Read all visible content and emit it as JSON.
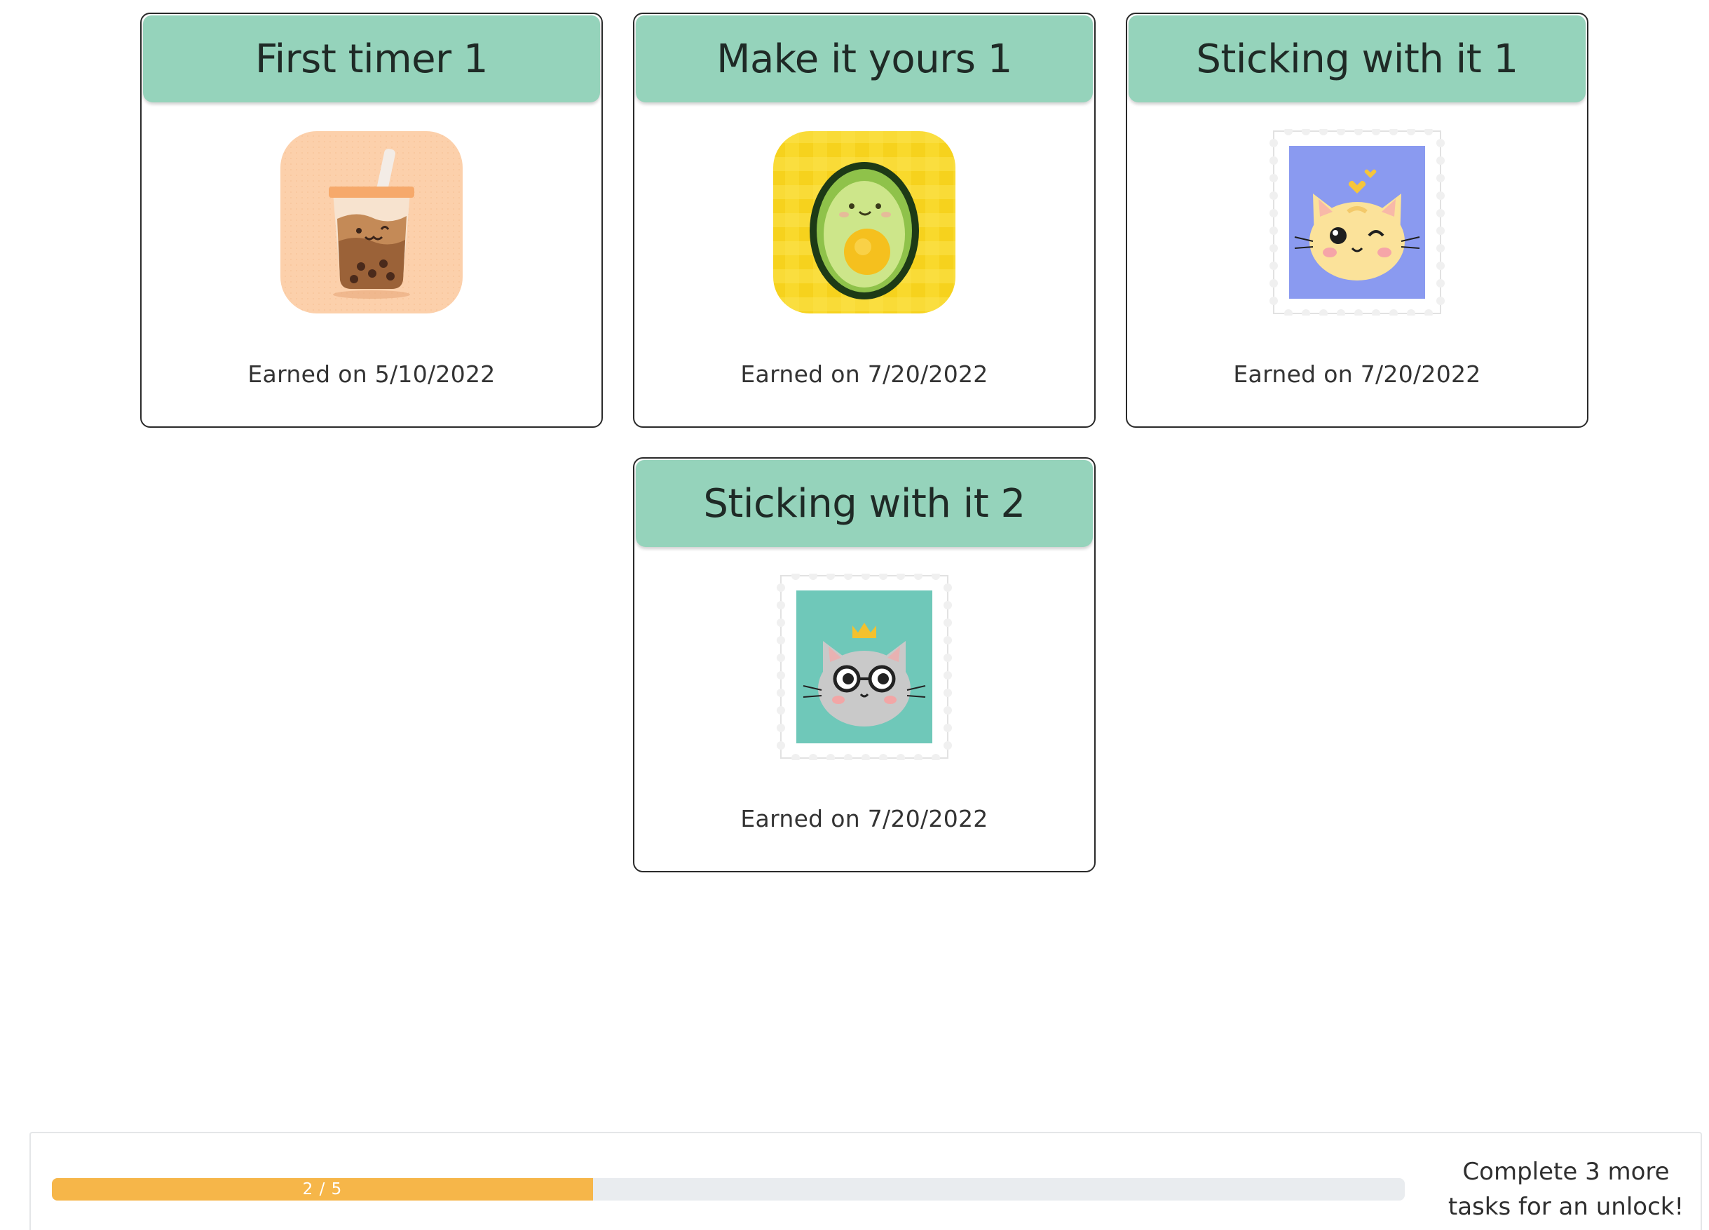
{
  "badges": [
    {
      "title": "First timer 1",
      "earned": "Earned on 5/10/2022",
      "icon": "bubble-tea-icon"
    },
    {
      "title": "Make it yours 1",
      "earned": "Earned on 7/20/2022",
      "icon": "avocado-icon"
    },
    {
      "title": "Sticking with it 1",
      "earned": "Earned on 7/20/2022",
      "icon": "yellow-cat-stamp-icon"
    },
    {
      "title": "Sticking with it 2",
      "earned": "Earned on 7/20/2022",
      "icon": "gray-cat-king-stamp-icon"
    }
  ],
  "progress": {
    "label": "2 / 5",
    "completed": 2,
    "total": 5,
    "fraction": 0.4,
    "message_line1": "Complete 3 more",
    "message_line2": "tasks for an unlock!"
  },
  "colors": {
    "header": "#95d3bb",
    "progress_fill": "#f6b649",
    "progress_track": "#e9ecef"
  }
}
